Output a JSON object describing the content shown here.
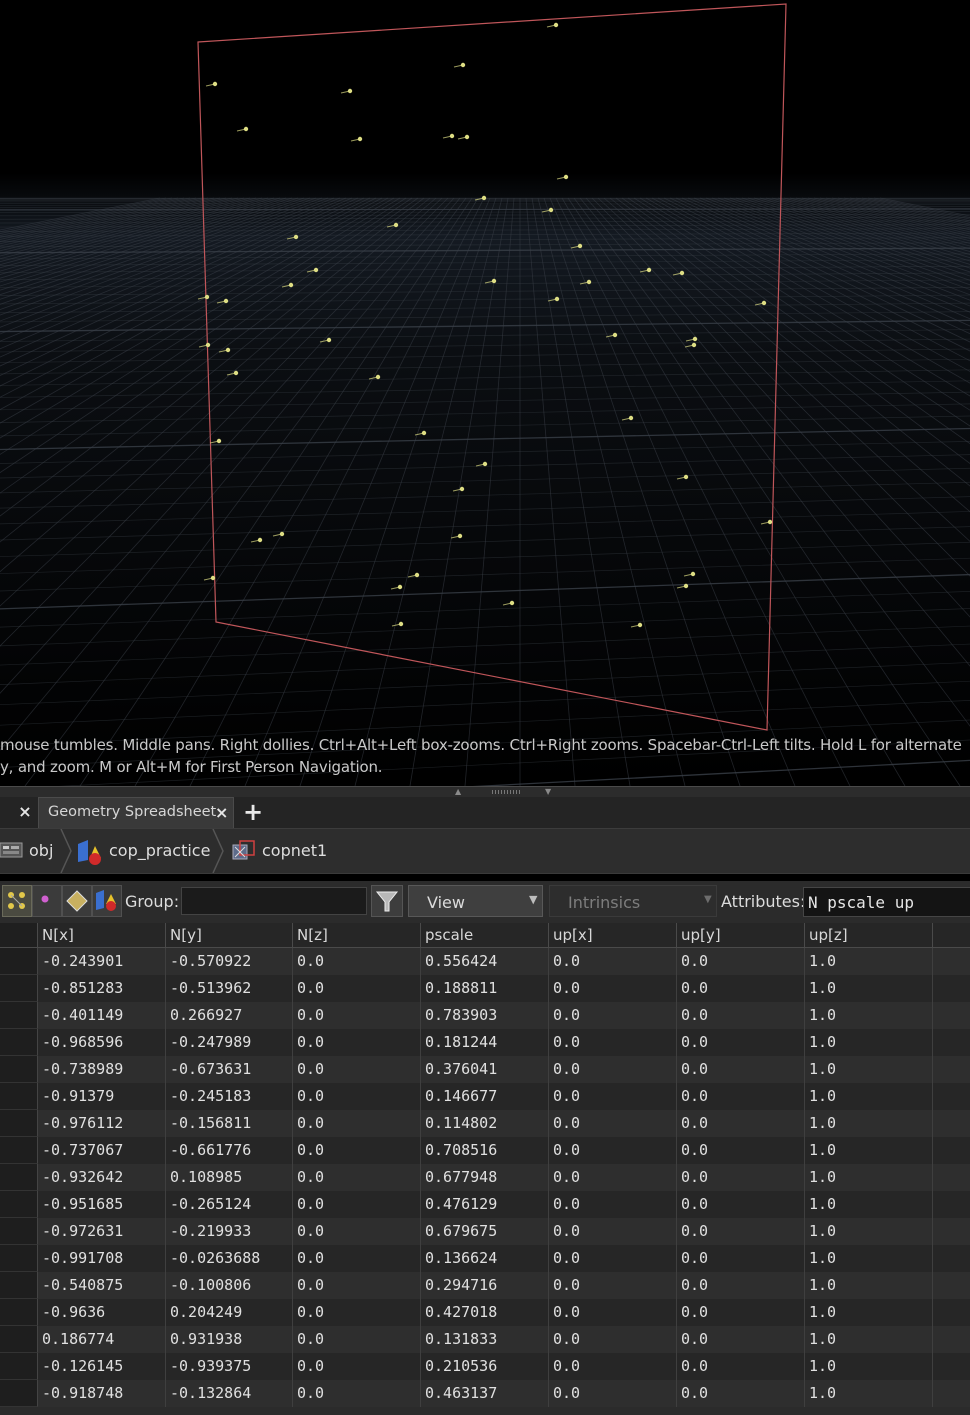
{
  "viewport": {
    "hint_line1": "mouse tumbles. Middle pans. Right dollies. Ctrl+Alt+Left box-zooms. Ctrl+Right zooms. Spacebar-Ctrl-Left tilts. Hold L for alternate",
    "hint_line2": "y, and zoom. M or Alt+M for First Person Navigation.",
    "colors": {
      "frame": "#c0565a",
      "points": "#dede84",
      "grid": "#3a4048"
    }
  },
  "tabs": {
    "active_label": "Geometry Spreadsheet",
    "close_icon": "close-icon",
    "add_icon": "plus-icon"
  },
  "path": {
    "items": [
      {
        "label": "obj",
        "icon": "obj-network-icon"
      },
      {
        "label": "cop_practice",
        "icon": "cop-shapes-icon"
      },
      {
        "label": "copnet1",
        "icon": "copnet-icon"
      }
    ]
  },
  "toolbar": {
    "group_label": "Group:",
    "group_value": "",
    "view_label": "View",
    "intrinsics_label": "Intrinsics",
    "attributes_label": "Attributes:",
    "attributes_value": "N pscale up"
  },
  "table": {
    "columns": [
      "N[x]",
      "N[y]",
      "N[z]",
      "pscale",
      "up[x]",
      "up[y]",
      "up[z]"
    ],
    "rows": [
      [
        "-0.243901",
        "-0.570922",
        "0.0",
        "0.556424",
        "0.0",
        "0.0",
        "1.0"
      ],
      [
        "-0.851283",
        "-0.513962",
        "0.0",
        "0.188811",
        "0.0",
        "0.0",
        "1.0"
      ],
      [
        "-0.401149",
        "0.266927",
        "0.0",
        "0.783903",
        "0.0",
        "0.0",
        "1.0"
      ],
      [
        "-0.968596",
        "-0.247989",
        "0.0",
        "0.181244",
        "0.0",
        "0.0",
        "1.0"
      ],
      [
        "-0.738989",
        "-0.673631",
        "0.0",
        "0.376041",
        "0.0",
        "0.0",
        "1.0"
      ],
      [
        "-0.91379",
        "-0.245183",
        "0.0",
        "0.146677",
        "0.0",
        "0.0",
        "1.0"
      ],
      [
        "-0.976112",
        "-0.156811",
        "0.0",
        "0.114802",
        "0.0",
        "0.0",
        "1.0"
      ],
      [
        "-0.737067",
        "-0.661776",
        "0.0",
        "0.708516",
        "0.0",
        "0.0",
        "1.0"
      ],
      [
        "-0.932642",
        "0.108985",
        "0.0",
        "0.677948",
        "0.0",
        "0.0",
        "1.0"
      ],
      [
        "-0.951685",
        "-0.265124",
        "0.0",
        "0.476129",
        "0.0",
        "0.0",
        "1.0"
      ],
      [
        "-0.972631",
        "-0.219933",
        "0.0",
        "0.679675",
        "0.0",
        "0.0",
        "1.0"
      ],
      [
        "-0.991708",
        "-0.0263688",
        "0.0",
        "0.136624",
        "0.0",
        "0.0",
        "1.0"
      ],
      [
        "-0.540875",
        "-0.100806",
        "0.0",
        "0.294716",
        "0.0",
        "0.0",
        "1.0"
      ],
      [
        "-0.9636",
        "0.204249",
        "0.0",
        "0.427018",
        "0.0",
        "0.0",
        "1.0"
      ],
      [
        "0.186774",
        "0.931938",
        "0.0",
        "0.131833",
        "0.0",
        "0.0",
        "1.0"
      ],
      [
        "-0.126145",
        "-0.939375",
        "0.0",
        "0.210536",
        "0.0",
        "0.0",
        "1.0"
      ],
      [
        "-0.918748",
        "-0.132864",
        "0.0",
        "0.463137",
        "0.0",
        "0.0",
        "1.0"
      ]
    ]
  }
}
